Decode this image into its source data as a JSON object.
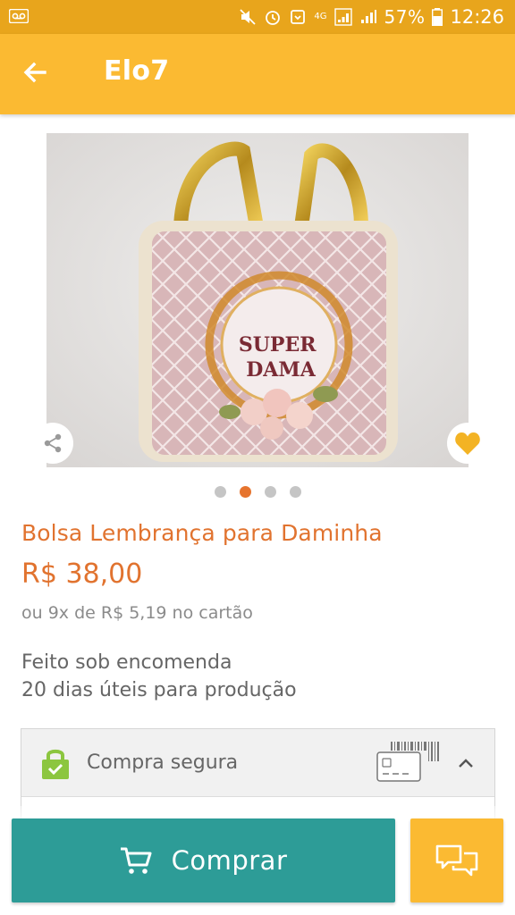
{
  "status_bar": {
    "battery": "57%",
    "time": "12:26",
    "network": "4G",
    "icons": [
      "voicemail-icon",
      "mute-icon",
      "alarm-icon",
      "notification-icon",
      "signal-4g-icon",
      "signal-icon",
      "battery-icon"
    ]
  },
  "app_bar": {
    "title": "Elo7",
    "back_icon": "arrow-left-icon"
  },
  "gallery": {
    "image_caption": "SUPER DAMA",
    "image_count": 4,
    "active_index": 1,
    "share_icon": "share-icon",
    "favorite_icon": "heart-icon"
  },
  "product": {
    "title": "Bolsa Lembrança para Daminha",
    "price": "R$ 38,00",
    "installments": "ou 9x de R$ 5,19 no cartão",
    "made_to_order": "Feito sob encomenda",
    "production_time": "20 dias úteis para produção"
  },
  "secure_purchase": {
    "label": "Compra segura",
    "lock_icon": "lock-icon",
    "card_icon": "credit-card-icon",
    "chevron_icon": "chevron-up-icon"
  },
  "actions": {
    "buy_label": "Comprar",
    "cart_icon": "cart-icon",
    "chat_icon": "chat-icon"
  },
  "colors": {
    "status_bar": "#e8a51c",
    "app_bar": "#fbba32",
    "accent_orange": "#e1732f",
    "buy_button": "#2d9c97",
    "lock_green": "#8cc63f"
  }
}
